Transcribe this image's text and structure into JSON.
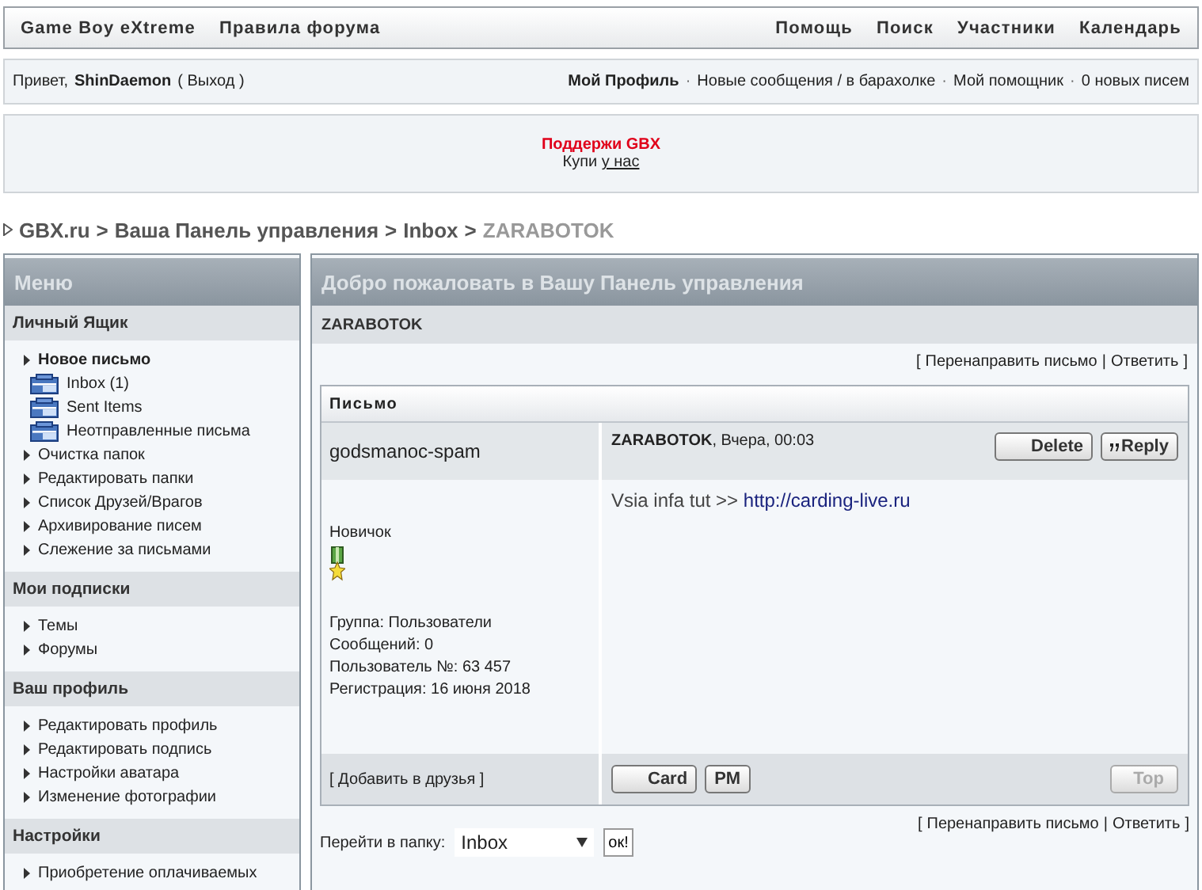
{
  "nav": {
    "left": [
      "Game Boy eXtreme",
      "Правила форума"
    ],
    "right": [
      "Помощь",
      "Поиск",
      "Участники",
      "Календарь"
    ]
  },
  "user_bar": {
    "greeting": "Привет,",
    "username": "ShinDaemon",
    "logout": "( Выход )",
    "separator": "·",
    "links": [
      {
        "label": "Мой Профиль",
        "bold": true
      },
      {
        "label": "Новые сообщения / в барахолке",
        "bold": false
      },
      {
        "label": "Мой помощник",
        "bold": false
      },
      {
        "label": "0 новых писем",
        "bold": false
      }
    ]
  },
  "banner": {
    "title": "Поддержи GBX",
    "text": "Купи",
    "link": "у нас"
  },
  "breadcrumb": {
    "separator": ">",
    "items": [
      "GBX.ru",
      "Ваша Панель управления",
      "Inbox"
    ],
    "current": "ZARABOTOK"
  },
  "sidebar": {
    "title": "Меню",
    "sections": [
      {
        "title": "Личный Ящик",
        "items": [
          {
            "label": "Новое письмо",
            "kind": "bullet",
            "bold": true
          },
          {
            "label": "Inbox (1)",
            "kind": "folder",
            "bold": false
          },
          {
            "label": "Sent Items",
            "kind": "folder",
            "bold": false
          },
          {
            "label": "Неотправленные письма",
            "kind": "folder",
            "bold": false
          },
          {
            "label": "Очистка папок",
            "kind": "bullet",
            "bold": false
          },
          {
            "label": "Редактировать папки",
            "kind": "bullet",
            "bold": false
          },
          {
            "label": "Список Друзей/Врагов",
            "kind": "bullet",
            "bold": false
          },
          {
            "label": "Архивирование писем",
            "kind": "bullet",
            "bold": false
          },
          {
            "label": "Слежение за письмами",
            "kind": "bullet",
            "bold": false
          }
        ]
      },
      {
        "title": "Мои подписки",
        "items": [
          {
            "label": "Темы",
            "kind": "bullet",
            "bold": false
          },
          {
            "label": "Форумы",
            "kind": "bullet",
            "bold": false
          }
        ]
      },
      {
        "title": "Ваш профиль",
        "items": [
          {
            "label": "Редактировать профиль",
            "kind": "bullet",
            "bold": false
          },
          {
            "label": "Редактировать подпись",
            "kind": "bullet",
            "bold": false
          },
          {
            "label": "Настройки аватара",
            "kind": "bullet",
            "bold": false
          },
          {
            "label": "Изменение фотографии",
            "kind": "bullet",
            "bold": false
          }
        ]
      },
      {
        "title": "Настройки",
        "items": [
          {
            "label": "Приобретение оплачиваемых",
            "kind": "bullet",
            "bold": false
          }
        ]
      }
    ]
  },
  "main": {
    "title": "Добро пожаловать в Вашу Панель управления",
    "subject": "ZARABOTOK",
    "actions": {
      "open": "[",
      "close": "]",
      "divider": "|",
      "links": [
        "Перенаправить письмо",
        "Ответить"
      ]
    },
    "message": {
      "header": "Письмо",
      "author": "godsmanoc-spam",
      "title": "ZARABOTOK",
      "date": ", Вчера, 00:03",
      "buttons": [
        {
          "label": "Delete",
          "kind": "plain"
        },
        {
          "label": "Reply",
          "kind": "quote"
        }
      ],
      "rank": "Новичок",
      "info": [
        "Группа: Пользователи",
        "Сообщений: 0",
        "Пользователь №: 63 457",
        "Регистрация: 16 июня 2018"
      ],
      "body_text": "Vsia infa tut >>",
      "body_link": "http://carding-live.ru",
      "add_friend": "[ Добавить в друзья ]",
      "footer_buttons": [
        {
          "label": "Card",
          "disabled": false
        },
        {
          "label": "PM",
          "disabled": false
        }
      ],
      "top_button": {
        "label": "Top",
        "disabled": true
      }
    },
    "folder_jump": {
      "label": "Перейти в папку:",
      "value": "Inbox",
      "button": "ок!"
    },
    "bottom_actions": {
      "open": "[",
      "close": "]",
      "divider": "|",
      "links": [
        "Перенаправить письмо",
        "Ответить"
      ]
    }
  }
}
